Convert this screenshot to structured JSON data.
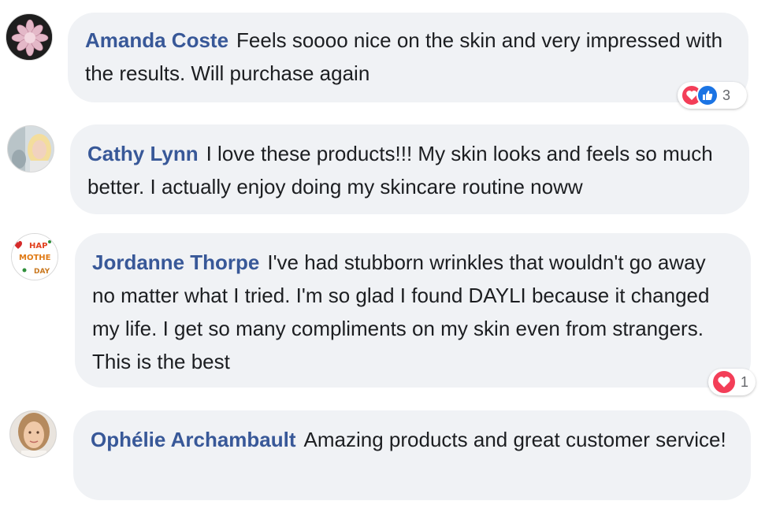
{
  "comments": [
    {
      "author": "Amanda Coste",
      "text": "Feels soooo nice on the skin and very impressed with the results. Will purchase again",
      "reactions": {
        "types": [
          "love",
          "like"
        ],
        "count": "3"
      }
    },
    {
      "author": "Cathy Lynn",
      "text": "I love these products!!! My skin looks and feels so much better. I actually enjoy doing my skincare routine noww"
    },
    {
      "author": "Jordanne Thorpe",
      "text": "I've had stubborn wrinkles that wouldn't go away no matter what I tried. I'm so glad I found DAYLI because it changed my life. I get so many compliments on my skin even from strangers. This is the best",
      "avatar_text": "HAPPY MOTHER'S DAY",
      "reactions": {
        "types": [
          "love"
        ],
        "count": "1"
      }
    },
    {
      "author": "Ophélie Archambault",
      "text": "Amazing products and great customer service!"
    }
  ],
  "colors": {
    "name": "#385898",
    "bubble": "#f0f2f5",
    "text": "#1c1e21",
    "love": "#f33e58",
    "like": "#1b74e4"
  }
}
